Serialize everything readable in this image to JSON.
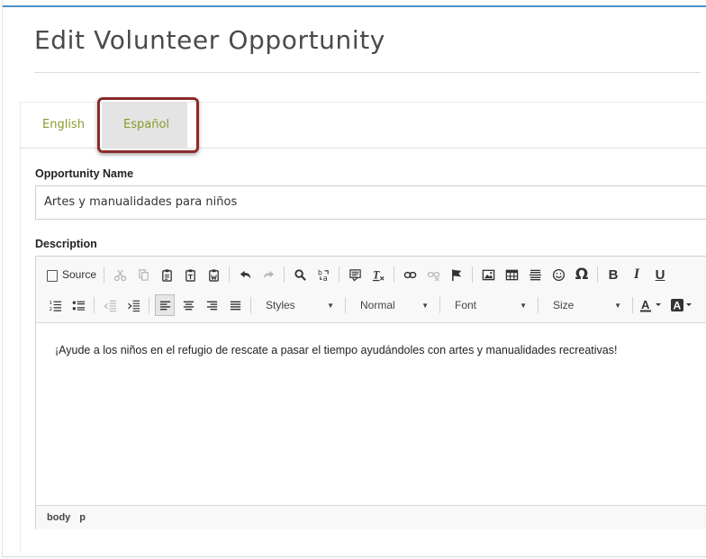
{
  "page": {
    "title": "Edit Volunteer Opportunity"
  },
  "tabs": [
    {
      "label": "English"
    },
    {
      "label": "Español",
      "selected": true
    }
  ],
  "form": {
    "name_label": "Opportunity Name",
    "name_value": "Artes y manualidades para niños",
    "description_label": "Description"
  },
  "editor": {
    "source_label": "Source",
    "styles_label": "Styles",
    "format_label": "Normal",
    "font_label": "Font",
    "size_label": "Size",
    "bold_label": "B",
    "italic_label": "I",
    "underline_label": "U",
    "omega_label": "Ω",
    "content": "¡Ayude a los niños en el refugio de rescate a pasar el tiempo ayudándoles con artes y manualidades recreativas!",
    "status_path": [
      "body",
      "p"
    ]
  },
  "colors": {
    "accent_blue": "#4a90c8",
    "tab_text": "#8a9a2a",
    "highlight_border": "#8c2a2a"
  }
}
